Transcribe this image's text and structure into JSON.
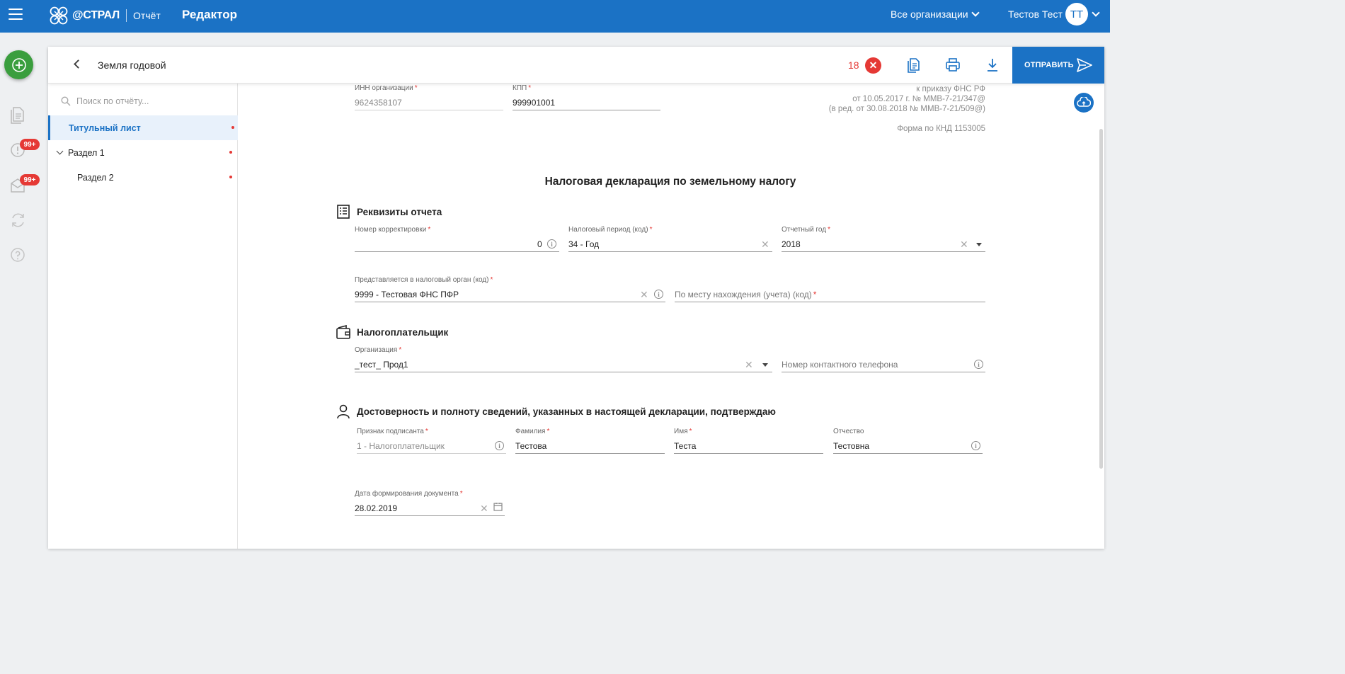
{
  "header": {
    "brand": "@СТРАЛ",
    "product": "Отчёт",
    "title": "Редактор",
    "orgs_label": "Все организации",
    "user_name": "Тестов Тест",
    "avatar_initials": "ТТ",
    "color": "#1b72c5"
  },
  "rail": {
    "badge_requirements": "99+",
    "badge_messages": "99+"
  },
  "report": {
    "title": "Земля годовой",
    "error_count": "18",
    "send_label": "ОТПРАВИТЬ"
  },
  "sidebar": {
    "search_placeholder": "Поиск по отчёту...",
    "items": [
      {
        "label": "Титульный лист",
        "active": true,
        "has_error": true
      },
      {
        "label": "Раздел 1",
        "expandable": true,
        "has_error": true
      },
      {
        "label": "Раздел 2",
        "has_error": true
      }
    ]
  },
  "form": {
    "inn_label": "ИНН организации",
    "inn_value": "9624358107",
    "kpp_label": "КПП",
    "kpp_value": "999901001",
    "note_line1": "к приказу ФНС РФ",
    "note_line2": "от 10.05.2017 г. № ММВ-7-21/347@",
    "note_line3": "(в ред. от 30.08.2018 № ММВ-7-21/509@)",
    "knd": "Форма по КНД 1153005",
    "doc_title": "Налоговая декларация по земельному налогу",
    "section_requisites": "Реквизиты отчета",
    "correction_label": "Номер корректировки",
    "correction_value": "0",
    "period_label": "Налоговый период (код)",
    "period_value": "34 - Год",
    "year_label": "Отчетный год",
    "year_value": "2018",
    "tax_authority_label": "Представляется в налоговый орган (код)",
    "tax_authority_value": "9999 - Тестовая ФНС ПФР",
    "location_placeholder": "По месту нахождения (учета) (код)",
    "section_taxpayer": "Налогоплательщик",
    "org_label": "Организация",
    "org_value": "_тест_ Прод1",
    "phone_placeholder": "Номер контактного телефона",
    "section_confirm": "Достоверность и полноту сведений, указанных в настоящей декларации, подтверждаю",
    "signer_label": "Признак подписанта",
    "signer_value": "1 - Налогоплательщик",
    "surname_label": "Фамилия",
    "surname_value": "Тестова",
    "name_label": "Имя",
    "name_value": "Теста",
    "patronymic_label": "Отчество",
    "patronymic_value": "Тестовна",
    "date_label": "Дата формирования документа",
    "date_value": "28.02.2019",
    "required_mark": "*"
  }
}
